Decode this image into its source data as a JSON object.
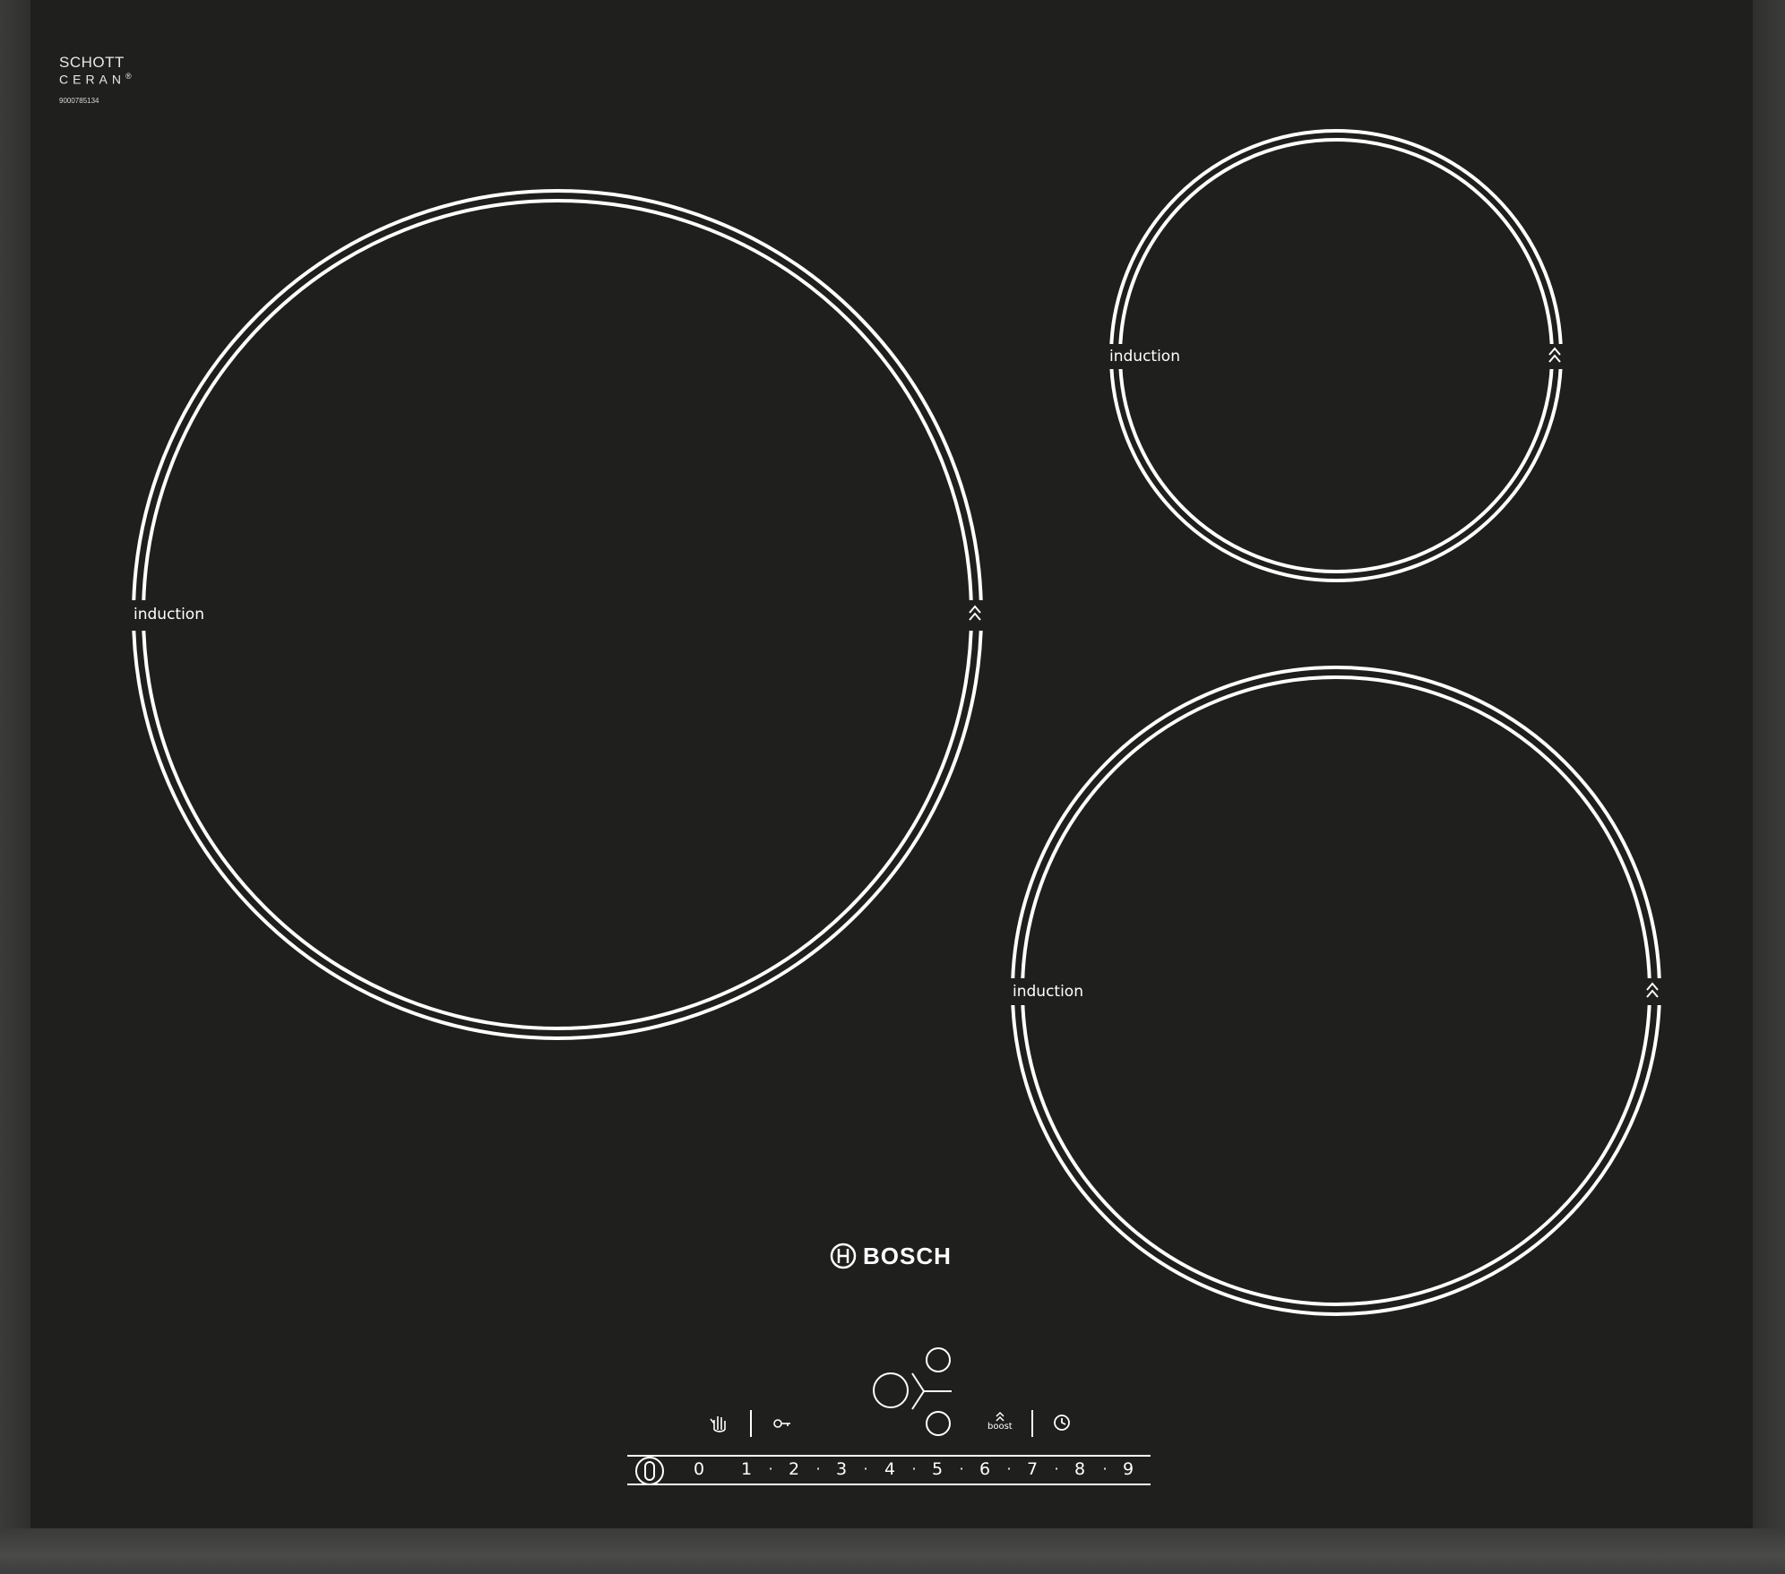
{
  "brand": {
    "glass_maker_line1": "SCHOTT",
    "glass_maker_line2": "CERAN",
    "registered_mark": "®",
    "serial": "9000785134",
    "manufacturer": "BOSCH"
  },
  "zones": [
    {
      "label": "induction",
      "boost_icon": "double-chevron-up-icon"
    },
    {
      "label": "induction",
      "boost_icon": "double-chevron-up-icon"
    },
    {
      "label": "induction",
      "boost_icon": "double-chevron-up-icon"
    }
  ],
  "controls": {
    "wipe_protect_icon": "hand-icon",
    "child_lock_icon": "key-icon",
    "zone_selector_icon": "three-zone-selector-icon",
    "boost_label": "boost",
    "timer_icon": "clock-icon",
    "power_icon": "power-icon",
    "power_levels": [
      "0",
      "1",
      "2",
      "3",
      "4",
      "5",
      "6",
      "7",
      "8",
      "9"
    ],
    "level_separator": "·"
  },
  "colors": {
    "glass": "#1f1f1d",
    "frame": "#2e2e2d",
    "print": "#ffffff"
  }
}
